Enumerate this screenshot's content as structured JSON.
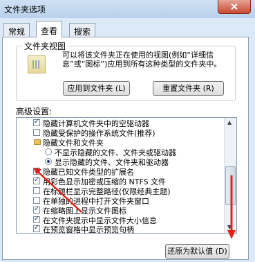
{
  "window": {
    "title": "文件夹选项"
  },
  "tabs": [
    {
      "label": "常规"
    },
    {
      "label": "查看"
    },
    {
      "label": "搜索"
    }
  ],
  "folder_views": {
    "title": "文件夹视图",
    "description": "可以将该文件夹正在使用的视图(例如“详细信息”或“图标”)应用到所有这种类型的文件夹中。",
    "apply_button": "应用到文件夹 (L)",
    "reset_button": "重置文件夹 (R)"
  },
  "advanced": {
    "label": "高级设置:",
    "items": [
      {
        "text": "隐藏计算机文件夹中的空驱动器",
        "checked": true
      },
      {
        "text": "隐藏受保护的操作系统文件(推荐)",
        "checked": false
      },
      {
        "text": "隐藏文件和文件夹",
        "kind": "folder"
      },
      {
        "text": "不显示隐藏的文件、文件夹或驱动器",
        "selected": false
      },
      {
        "text": "显示隐藏的文件、文件夹和驱动器",
        "selected": true
      },
      {
        "text": "隐藏已知文件类型的扩展名",
        "checked": true
      },
      {
        "text": "用彩色显示加密或压缩的 NTFS 文件",
        "checked": true
      },
      {
        "text": "在标题栏显示完整路径(仅限经典主题)",
        "checked": false
      },
      {
        "text": "在单独的进程中打开文件夹窗口",
        "checked": false
      },
      {
        "text": "在缩略图上显示文件图标",
        "checked": true
      },
      {
        "text": "在文件夹提示中显示文件大小信息",
        "checked": true
      },
      {
        "text": "在预览窗格中显示预览句柄",
        "checked": true
      }
    ],
    "restore_button": "还原为默认值 (D)"
  },
  "colors": {
    "annotation_red": "#e2231a"
  }
}
